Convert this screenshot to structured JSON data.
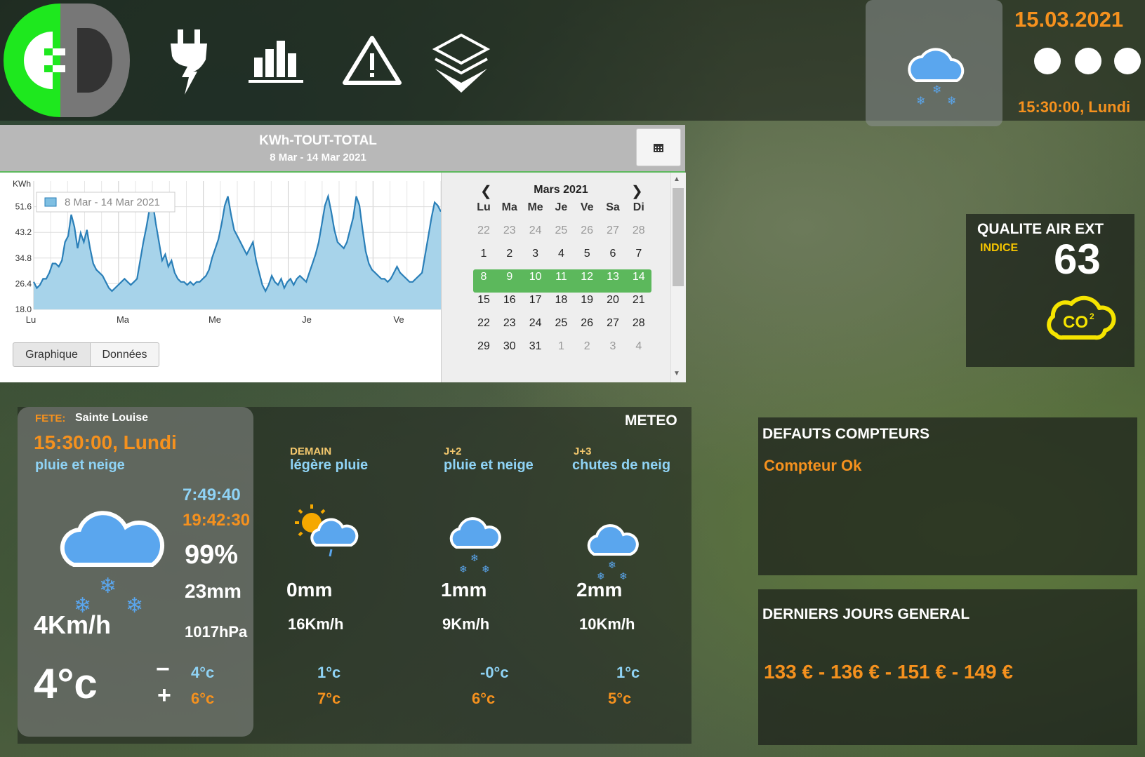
{
  "nav": {
    "items": [
      {
        "name": "energy",
        "icon": "plug-lightning-icon"
      },
      {
        "name": "stats",
        "icon": "bar-chart-icon"
      },
      {
        "name": "alerts",
        "icon": "warning-icon"
      },
      {
        "name": "layers",
        "icon": "layers-icon"
      }
    ]
  },
  "header": {
    "date": "15.03.2021",
    "time": "15:30:00, Lundi",
    "weather_icon": "cloud-snow-icon"
  },
  "chart_panel": {
    "title": "KWh-TOUT-TOTAL",
    "range": "8 Mar - 14 Mar 2021",
    "calendar_button_icon": "calendar-icon",
    "tabs": [
      "Graphique",
      "Données"
    ]
  },
  "chart_data": {
    "type": "area",
    "ylabel": "KWh",
    "legend": "8 Mar - 14 Mar 2021",
    "yticks": [
      "51.6",
      "43.2",
      "34.8",
      "26.4",
      "18.0"
    ],
    "ylim": [
      18.0,
      60.0
    ],
    "xticks": [
      "Lu",
      "Ma",
      "Me",
      "Je",
      "Ve"
    ],
    "values": [
      27,
      25,
      26,
      28,
      28,
      30,
      33,
      33,
      32,
      34,
      40,
      42,
      49,
      45,
      38,
      43,
      40,
      44,
      38,
      33,
      31,
      30,
      29,
      27,
      25,
      24,
      25,
      26,
      27,
      28,
      27,
      26,
      27,
      28,
      34,
      40,
      45,
      51,
      53,
      46,
      40,
      34,
      36,
      32,
      34,
      30,
      28,
      27,
      27,
      26,
      27,
      26,
      27,
      27,
      28,
      29,
      31,
      35,
      38,
      41,
      46,
      52,
      55,
      49,
      44,
      42,
      40,
      38,
      36,
      38,
      40,
      34,
      30,
      26,
      24,
      26,
      29,
      27,
      26,
      28,
      25,
      27,
      28,
      26,
      28,
      29,
      28,
      27,
      30,
      33,
      36,
      40,
      46,
      52,
      55,
      50,
      44,
      40,
      39,
      38,
      40,
      44,
      48,
      55,
      52,
      44,
      37,
      33,
      31,
      30,
      29,
      28,
      28,
      27,
      28,
      30,
      32,
      30,
      29,
      28,
      27,
      27,
      28,
      29,
      30,
      36,
      42,
      48,
      53,
      52,
      50
    ],
    "grid": true
  },
  "calendar": {
    "month": "Mars 2021",
    "weekdays": [
      "Lu",
      "Ma",
      "Me",
      "Je",
      "Ve",
      "Sa",
      "Di"
    ],
    "weeks": [
      [
        "22",
        "23",
        "24",
        "25",
        "26",
        "27",
        "28"
      ],
      [
        "1",
        "2",
        "3",
        "4",
        "5",
        "6",
        "7"
      ],
      [
        "8",
        "9",
        "10",
        "11",
        "12",
        "13",
        "14"
      ],
      [
        "15",
        "16",
        "17",
        "18",
        "19",
        "20",
        "21"
      ],
      [
        "22",
        "23",
        "24",
        "25",
        "26",
        "27",
        "28"
      ],
      [
        "29",
        "30",
        "31",
        "1",
        "2",
        "3",
        "4"
      ]
    ],
    "selected_week": 2,
    "selected_color": "#5cb85c"
  },
  "air": {
    "title": "QUALITE AIR EXT",
    "label": "INDICE",
    "value": "63",
    "icon": "co2-cloud-icon"
  },
  "meteo": {
    "title": "METEO",
    "fete_label": "FETE:",
    "fete_name": "Sainte Louise",
    "time": "15:30:00, Lundi",
    "condition": "pluie et neige",
    "sunrise": "7:49:40",
    "sunset": "19:42:30",
    "humidity": "99%",
    "rain": "23mm",
    "wind": "4Km/h",
    "pressure": "1017hPa",
    "temp": "4°c",
    "minus_sign": "−",
    "plus_sign": "+",
    "tmin": "4°c",
    "tmax": "6°c",
    "forecast": [
      {
        "day": "DEMAIN",
        "condition": "légère pluie",
        "rain": "0mm",
        "wind": "16Km/h",
        "tmin": "1°c",
        "tmax": "7°c",
        "icon": "sun-cloud-rain-icon"
      },
      {
        "day": "J+2",
        "condition": "pluie et neige",
        "rain": "1mm",
        "wind": "9Km/h",
        "tmin": "-0°c",
        "tmax": "6°c",
        "icon": "cloud-snow-icon"
      },
      {
        "day": "J+3",
        "condition": "chutes de neig",
        "rain": "2mm",
        "wind": "10Km/h",
        "tmin": "1°c",
        "tmax": "5°c",
        "icon": "cloud-snow-icon"
      }
    ]
  },
  "defauts": {
    "title": "DEFAUTS COMPTEURS",
    "status": "Compteur Ok"
  },
  "jours": {
    "title": "DERNIERS JOURS GENERAL",
    "values": "133 € - 136 € - 151 € - 149 €"
  }
}
